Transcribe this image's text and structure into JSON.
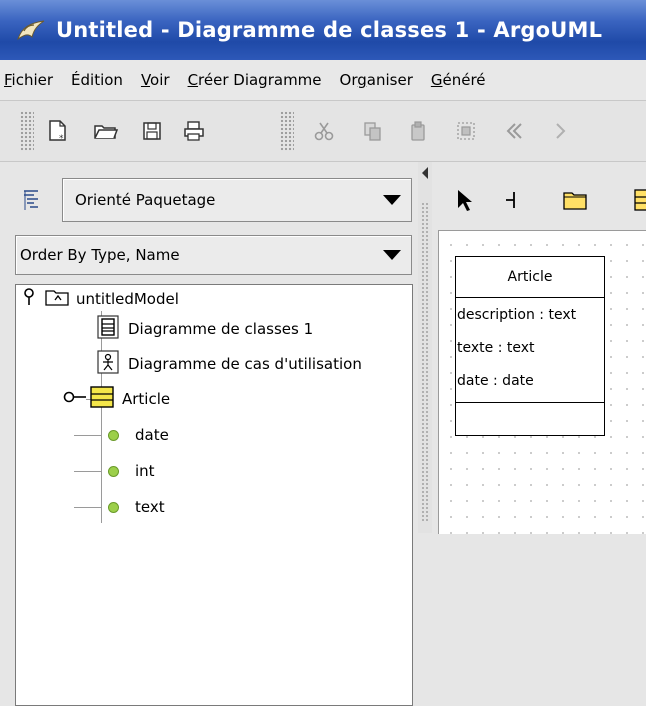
{
  "window": {
    "title": "Untitled - Diagramme de classes 1 - ArgoUML",
    "app_icon": "argouml-logo-icon"
  },
  "menubar": {
    "items": [
      {
        "label": "Fichier",
        "mnemonic": "F"
      },
      {
        "label": "Édition",
        "mnemonic": ""
      },
      {
        "label": "Voir",
        "mnemonic": "V"
      },
      {
        "label": "Créer Diagramme",
        "mnemonic": "C"
      },
      {
        "label": "Organiser",
        "mnemonic": "g"
      },
      {
        "label": "Généré",
        "mnemonic": "G"
      }
    ]
  },
  "toolbar": {
    "icons": [
      "new-document-icon",
      "open-folder-icon",
      "save-icon",
      "print-icon",
      "cut-icon",
      "copy-icon",
      "paste-icon",
      "remove-icon",
      "navigate-back-icon",
      "navigate-forward-icon"
    ]
  },
  "explorer": {
    "perspective": "Orienté Paquetage",
    "order": "Order By Type, Name",
    "tree": {
      "model": "untitledModel",
      "items": [
        {
          "label": "Diagramme de classes 1",
          "icon": "class-diagram-icon"
        },
        {
          "label": "Diagramme de cas d'utilisation",
          "icon": "usecase-diagram-icon"
        },
        {
          "label": "Article",
          "icon": "class-icon"
        }
      ],
      "attributes": [
        "date",
        "int",
        "text"
      ]
    }
  },
  "diagram": {
    "tools": [
      "select-arrow-icon",
      "broom-icon",
      "package-icon",
      "class-icon"
    ],
    "class": {
      "name": "Article",
      "attributes": [
        "description : text",
        "texte : text",
        "date : date"
      ]
    }
  },
  "colors": {
    "titlebar": "#2d58b8",
    "folder": "#ffe066",
    "class_icon": "#f4e64a",
    "leaf": "#9ccf4a"
  }
}
